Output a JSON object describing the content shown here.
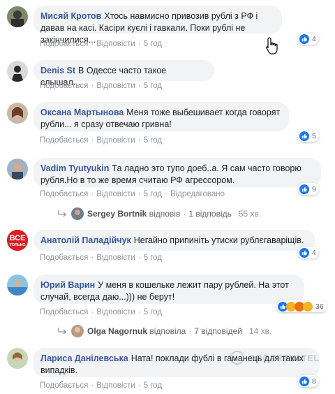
{
  "comments": [
    {
      "author": "Мисяй Кротов",
      "text": "Хтось навмисно привозив рублі з РФ і давав на касі. Касіри куєлі і гавкали. Поки рублі не закінчилися...",
      "like": "Подобається",
      "reply": "Відповісти",
      "time": "5 год",
      "reactions": "4"
    },
    {
      "author": "Denis St",
      "text": "В Одессе часто такое слышал...",
      "like": "Подобається",
      "reply": "Відповісти",
      "time": "5 год"
    },
    {
      "author": "Оксана Мартынова",
      "text": "Меня тоже выбешивает когда говорят рубли... я сразу отвечаю гривна!",
      "like": "Подобається",
      "reply": "Відповісти",
      "time": "5 год",
      "reactions": "5"
    },
    {
      "author": "Vadim Tyutyukin",
      "text": "Та ладно это тупо доеб..а. Я сам часто говорю рубля.Но в то же время считаю РФ агрессором.",
      "like": "Подобається",
      "reply": "Відповісти",
      "time": "5 год",
      "edited": "Відредаговано",
      "reactions": "9",
      "thread": {
        "name": "Sergey Bortnik",
        "verb": "відповів",
        "count": "1 відповідь",
        "time": "55 хв."
      }
    },
    {
      "author": "Анатолій Паладійчук",
      "text": "Негайно припиніть утиски рублєгаваріщів.",
      "like": "Подобається",
      "reply": "Відповісти",
      "time": "5 год",
      "reactions": "4",
      "avatar_text": "ВСЕ ТОЛЬКО"
    },
    {
      "author": "Юрий Варин",
      "text": "У меня в кошельке лежит пару рублей. На этот случай, всегда даю...))) не берут!",
      "like": "Подобається",
      "reply": "Відповісти",
      "time": "5 год",
      "reactions": "36",
      "thread": {
        "name": "Olga Nagornuk",
        "verb": "відповіла",
        "count": "7 відповідей",
        "time": "14 хв."
      }
    },
    {
      "author": "Лариса Данілевська",
      "text": "Ната! поклади фублі в гаманець для таких випадків.",
      "like": "Подобається",
      "reply": "Відповісти",
      "time": "5 год",
      "reactions": "8"
    }
  ],
  "watermark": "OBOZREVATEL",
  "colors": {
    "author": "#385898",
    "bubble": "#f2f3f5",
    "like": "#1877f2",
    "meta": "#90949c"
  }
}
